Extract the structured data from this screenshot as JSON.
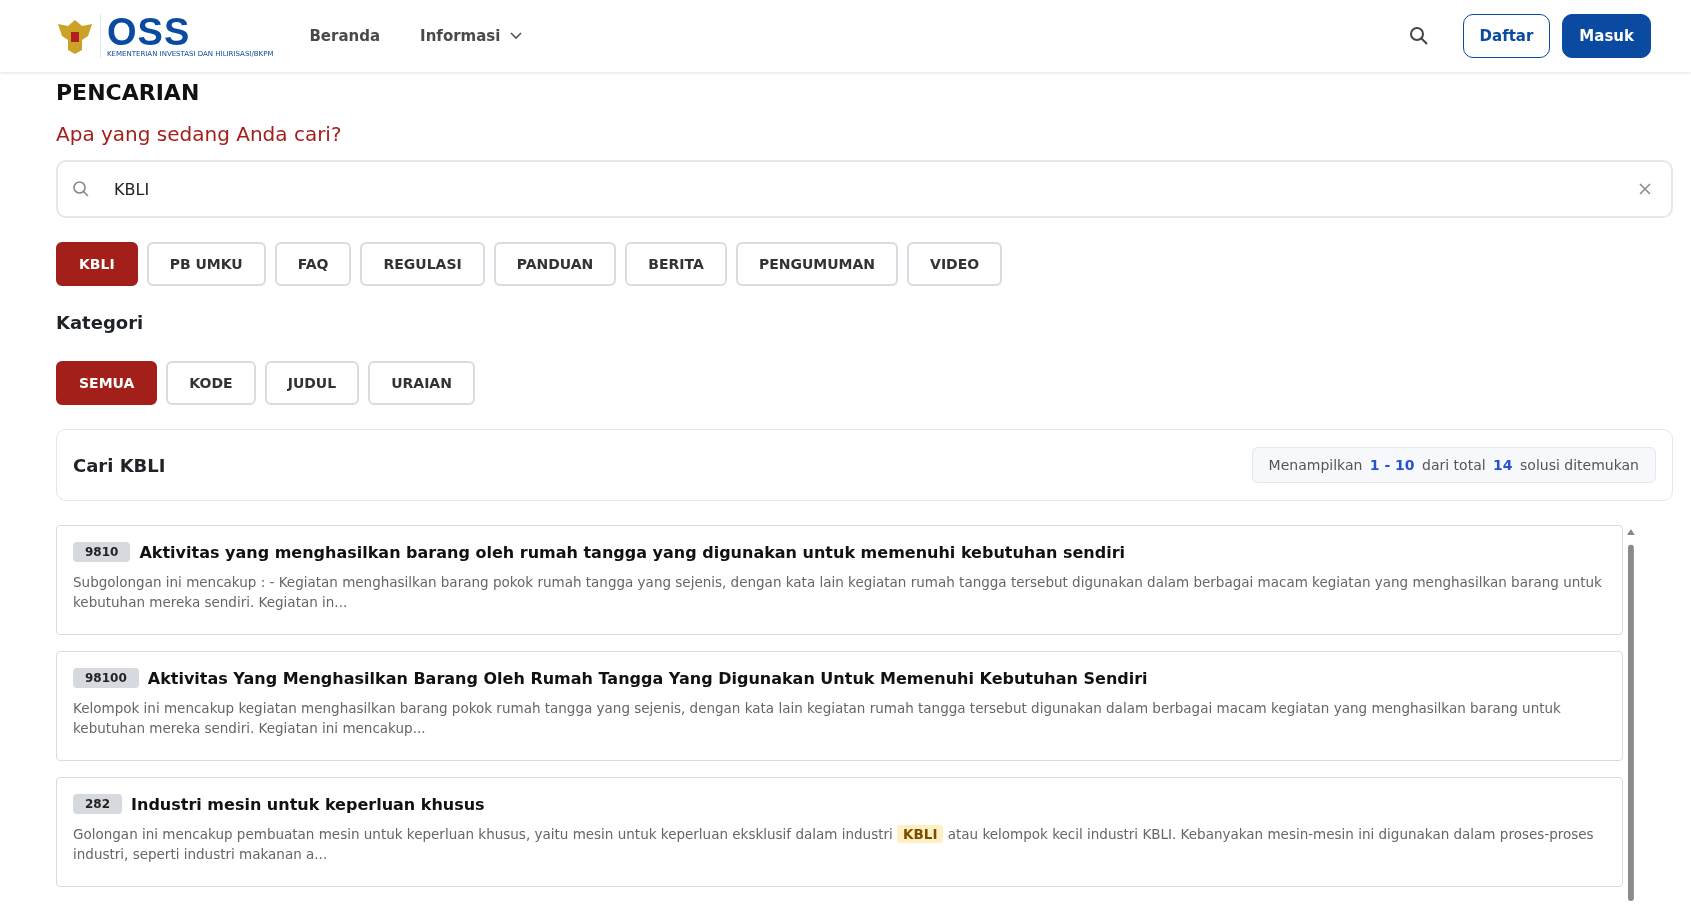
{
  "header": {
    "logo_text": "OSS",
    "logo_subtitle": "KEMENTERIAN INVESTASI DAN HILIRISASI/BKPM",
    "nav": [
      {
        "label": "Beranda",
        "kind": "link"
      },
      {
        "label": "Informasi",
        "kind": "dropdown"
      }
    ],
    "buttons": [
      {
        "label": "Daftar",
        "kind": "outline"
      },
      {
        "label": "Masuk",
        "kind": "primary"
      }
    ]
  },
  "page_title": "PENCARIAN",
  "question": "Apa yang sedang Anda cari?",
  "search": {
    "value": "KBLI"
  },
  "tabs": [
    {
      "label": "KBLI",
      "selected": true
    },
    {
      "label": "PB UMKU",
      "selected": false
    },
    {
      "label": "FAQ",
      "selected": false
    },
    {
      "label": "REGULASI",
      "selected": false
    },
    {
      "label": "PANDUAN",
      "selected": false
    },
    {
      "label": "BERITA",
      "selected": false
    },
    {
      "label": "PENGUMUMAN",
      "selected": false
    },
    {
      "label": "VIDEO",
      "selected": false
    }
  ],
  "category_heading": "Kategori",
  "categories": [
    {
      "label": "SEMUA",
      "selected": true
    },
    {
      "label": "KODE",
      "selected": false
    },
    {
      "label": "JUDUL",
      "selected": false
    },
    {
      "label": "URAIAN",
      "selected": false
    }
  ],
  "results_panel": {
    "title": "Cari KBLI",
    "summary": "Menampilkan **1 - 10** dari total **14** solusi ditemukan"
  },
  "results": [
    {
      "code": "9810",
      "title": "Aktivitas yang menghasilkan barang oleh rumah tangga yang digunakan untuk memenuhi kebutuhan sendiri",
      "description": [
        {
          "text": "Subgolongan ini mencakup : - Kegiatan menghasilkan barang pokok rumah tangga yang sejenis, dengan kata lain kegiatan rumah tangga tersebut digunakan dalam berbagai macam kegiatan yang menghasilkan barang untuk kebutuhan mereka sendiri. Kegiatan in...",
          "highlighted": false
        }
      ]
    },
    {
      "code": "98100",
      "title": "Aktivitas Yang Menghasilkan Barang Oleh Rumah Tangga Yang Digunakan Untuk Memenuhi Kebutuhan Sendiri",
      "description": [
        {
          "text": "Kelompok ini mencakup kegiatan menghasilkan barang pokok rumah tangga yang sejenis, dengan kata lain kegiatan rumah tangga tersebut digunakan dalam berbagai macam kegiatan yang menghasilkan barang untuk kebutuhan mereka sendiri. Kegiatan ini mencakup...",
          "highlighted": false
        }
      ]
    },
    {
      "code": "282",
      "title": "Industri mesin untuk keperluan khusus",
      "description": [
        {
          "text": "Golongan ini mencakup pembuatan mesin untuk keperluan khusus, yaitu mesin untuk keperluan eksklusif dalam industri ",
          "highlighted": false
        },
        {
          "text": "KBLI",
          "highlighted": true
        },
        {
          "text": " atau kelompok kecil industri KBLI. Kebanyakan mesin-mesin ini digunakan dalam proses-proses industri, seperti industri makanan a...",
          "highlighted": false
        }
      ]
    }
  ]
}
